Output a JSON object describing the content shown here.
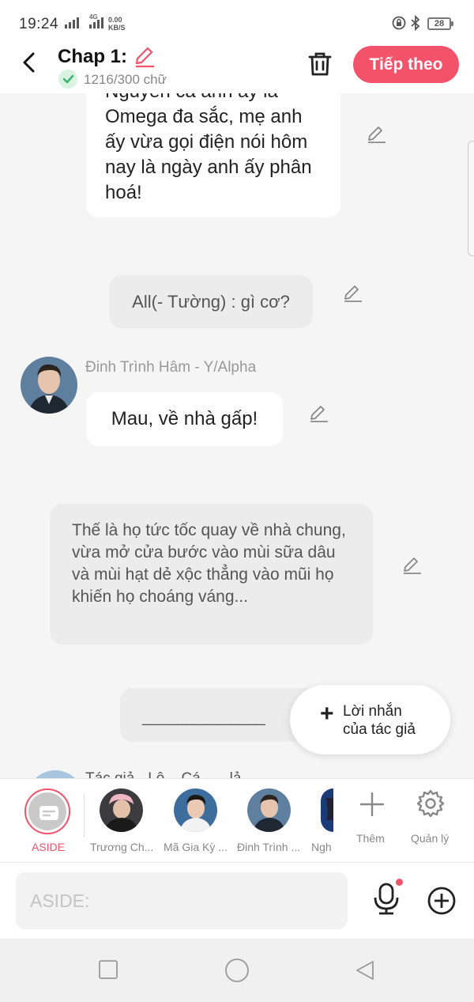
{
  "status_bar": {
    "time": "19:24",
    "network": "4G",
    "speed_value": "0.00",
    "speed_unit": "KB/S",
    "battery": "28"
  },
  "header": {
    "chapter_title": "Chap 1:",
    "word_count": "1216/300 chữ",
    "next_button": "Tiếp theo"
  },
  "messages": [
    {
      "type": "dialogue-cutoff",
      "text": "Nguyễn cả anh ấy là Omega đa sắc, mẹ anh ấy vừa gọi điện nói hôm nay là ngày anh ấy phân hoá!"
    },
    {
      "type": "aside",
      "text": "All(- Tường) : gì cơ?"
    },
    {
      "type": "dialogue",
      "speaker": "Đinh Trình Hâm - Y/Alpha",
      "text": "Mau, về nhà gấp!"
    },
    {
      "type": "aside",
      "text": "Thế là họ tức tốc quay về nhà chung, vừa mở cửa bước vào mùi sữa dâu và mùi hạt dẻ xộc thẳng vào mũi họ khiến họ choáng váng..."
    },
    {
      "type": "aside",
      "text": "______________"
    },
    {
      "type": "dialogue-cutoff",
      "speaker": "Tác giả - Lộ... Cá... ...lả"
    }
  ],
  "author_note_button": {
    "line1": "Lời nhắn",
    "line2": "của tác giả"
  },
  "character_bar": {
    "aside_label": "ASIDE",
    "characters": [
      {
        "name": "Trương Ch..."
      },
      {
        "name": "Mã Gia Kỳ ..."
      },
      {
        "name": "Đinh Trình ..."
      },
      {
        "name": "Ngh"
      }
    ],
    "add_label": "Thêm",
    "manage_label": "Quản lý"
  },
  "composer": {
    "placeholder": "ASIDE:"
  },
  "colors": {
    "accent": "#f2526a",
    "bubble_white": "#ffffff",
    "bubble_gray": "#ececec",
    "background": "#f5f5f5"
  },
  "icons": [
    "back-arrow-icon",
    "pencil-icon",
    "check-icon",
    "trash-icon",
    "plus-icon",
    "gear-icon",
    "mic-icon",
    "add-circle-icon",
    "nav-square-icon",
    "nav-circle-icon",
    "nav-triangle-icon"
  ]
}
